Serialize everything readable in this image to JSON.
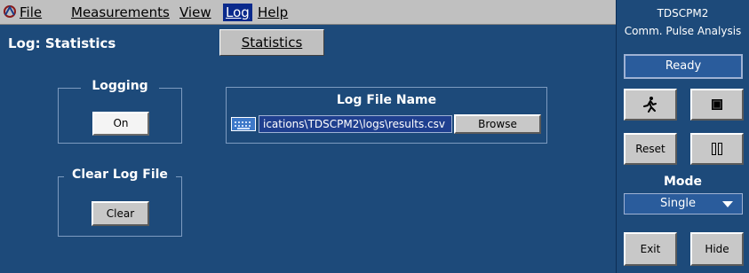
{
  "menu": {
    "file": "File",
    "measurements": "Measurements",
    "view": "View",
    "log": "Log",
    "help": "Help"
  },
  "dropdown": {
    "statistics": "Statistics"
  },
  "page": {
    "title": "Log: Statistics"
  },
  "logging": {
    "label": "Logging",
    "button": "On"
  },
  "logfile": {
    "label": "Log File Name",
    "path": "ications\\TDSCPM2\\logs\\results.csv",
    "browse": "Browse"
  },
  "clearlog": {
    "label": "Clear Log File",
    "button": "Clear"
  },
  "sidebar": {
    "app_name": "TDSCPM2",
    "subtitle": "Comm. Pulse Analysis",
    "status": "Ready",
    "reset": "Reset",
    "mode_label": "Mode",
    "mode_value": "Single",
    "exit": "Exit",
    "hide": "Hide"
  },
  "icons": {
    "run": "running-figure-icon",
    "stop": "stop-square-icon",
    "pause": "pause-icon",
    "app": "tektronix-app-icon",
    "keyboard": "keyboard-icon"
  }
}
